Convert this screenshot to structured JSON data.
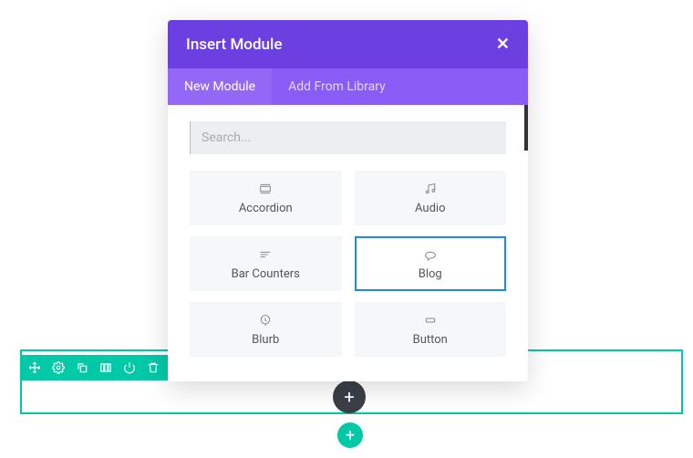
{
  "modal": {
    "title": "Insert Module",
    "tabs": {
      "new_module": "New Module",
      "add_from_library": "Add From Library"
    },
    "search_placeholder": "Search..."
  },
  "modules": {
    "accordion": "Accordion",
    "audio": "Audio",
    "bar_counters": "Bar Counters",
    "blog": "Blog",
    "blurb": "Blurb",
    "button": "Button"
  }
}
